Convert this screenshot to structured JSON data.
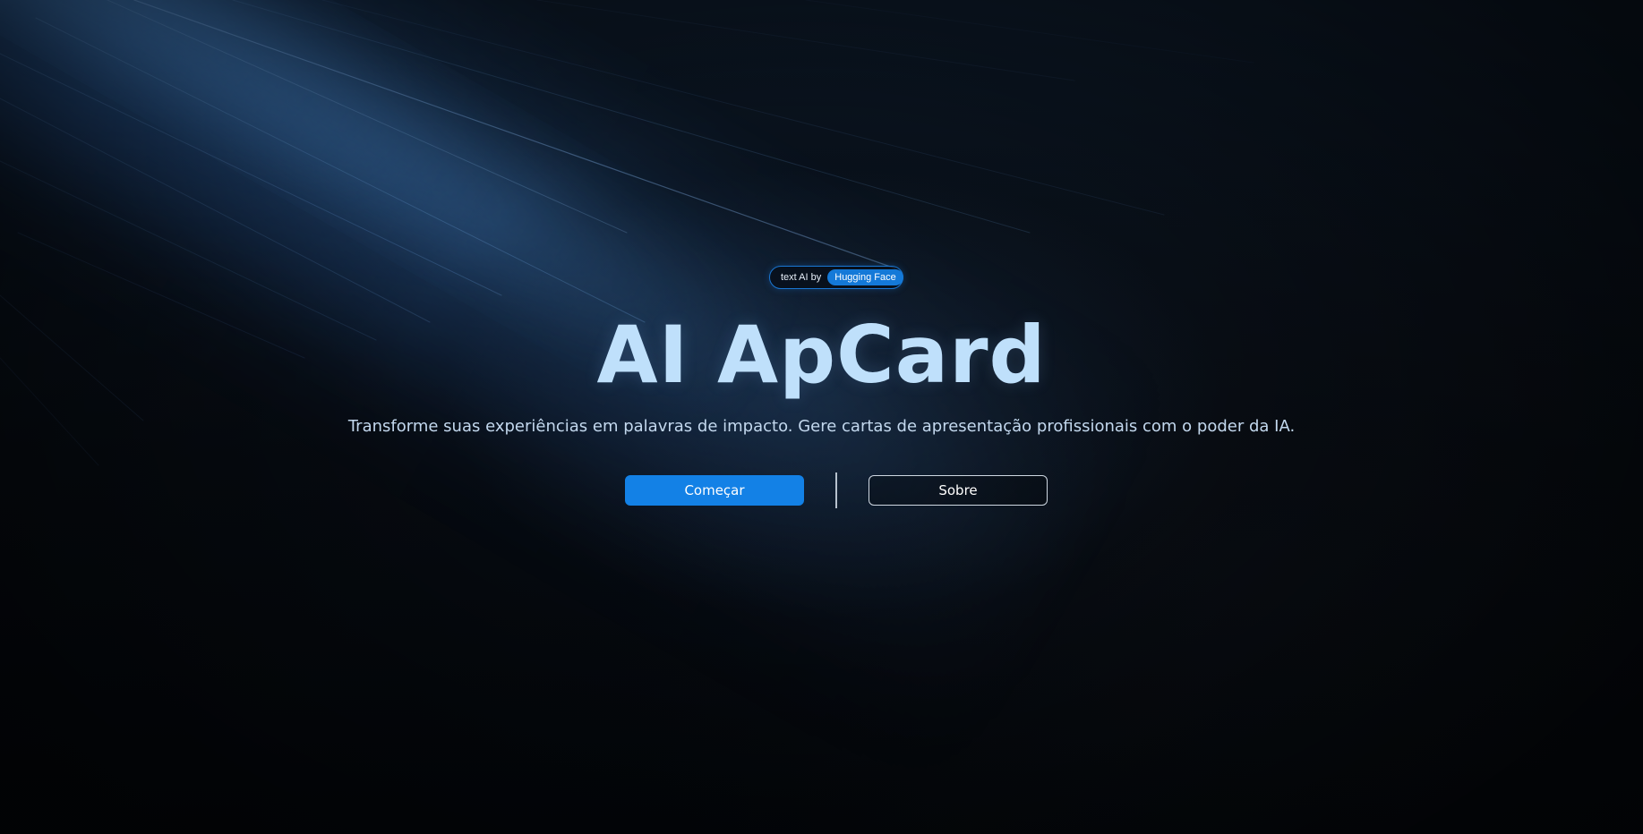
{
  "hero": {
    "badge": {
      "prefix": "text AI by",
      "pill": "Hugging Face"
    },
    "title": "AI ApCard",
    "subtitle": "Transforme suas experiências em palavras de impacto. Gere cartas de apresentação profissionais com o poder da IA."
  },
  "actions": {
    "primary_label": "Começar",
    "secondary_label": "Sobre"
  },
  "colors": {
    "background": "#04070c",
    "accent": "#1381e6",
    "title": "#bfe0fb",
    "subtitle": "#c3d8ee",
    "badge_border": "#1976d2"
  }
}
